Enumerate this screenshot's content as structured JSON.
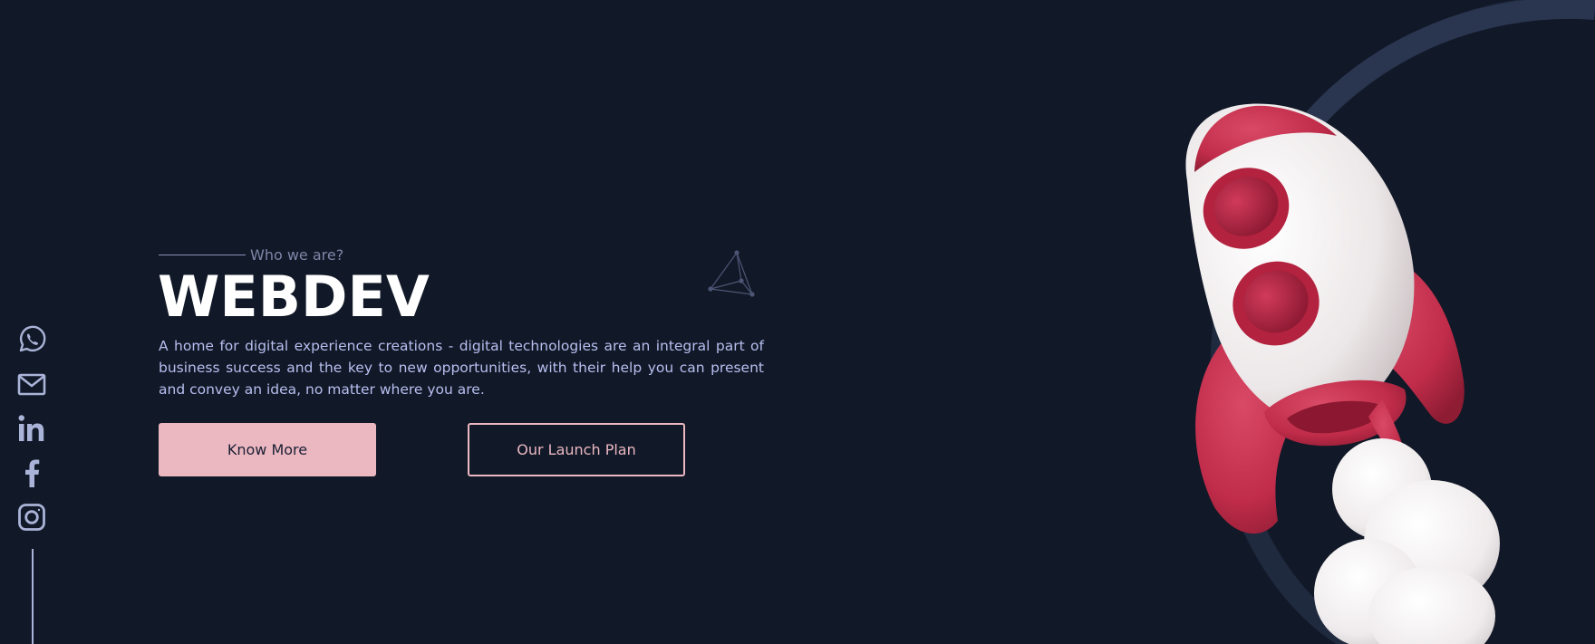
{
  "hero": {
    "eyebrow": "Who we are?",
    "title": "WEBDEV",
    "description": "A home for digital experience creations - digital technologies are an integral part of business success and the key to new opportunities, with their help you can present and convey an idea, no matter where you are.",
    "primary_button": "Know More",
    "secondary_button": "Our Launch Plan"
  },
  "social": {
    "icons": [
      "whatsapp-icon",
      "mail-icon",
      "linkedin-icon",
      "facebook-icon",
      "instagram-icon"
    ]
  },
  "colors": {
    "background": "#111827",
    "accent": "#ebb8c2",
    "text_light": "#b7bff0",
    "muted": "#7d86a8",
    "rocket_red": "#c8314f",
    "rocket_white": "#f2eeee"
  }
}
